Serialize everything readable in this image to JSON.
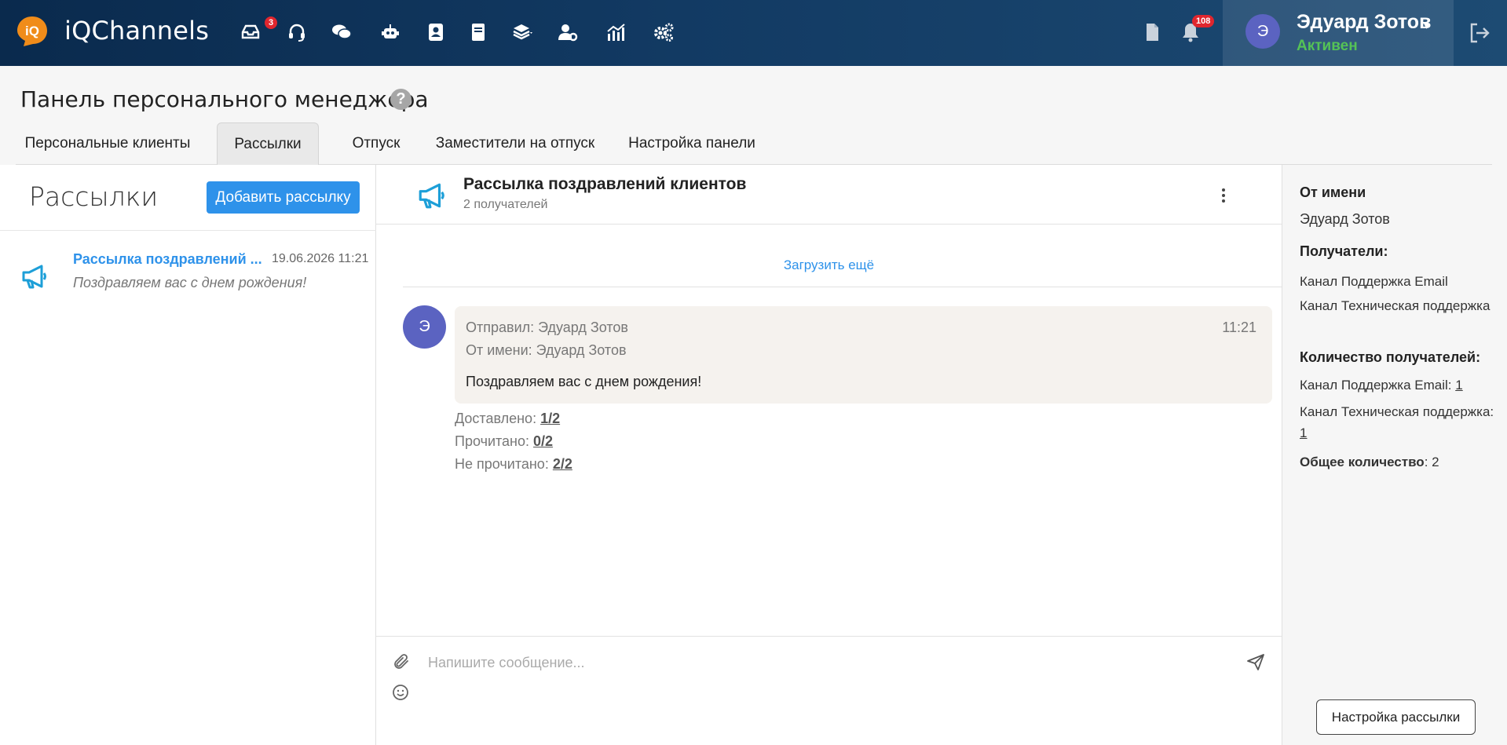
{
  "header": {
    "brand": "iQChannels",
    "nav_icons": [
      "inbox-icon",
      "headset-icon",
      "chat-icon",
      "robot-icon",
      "contacts-icon",
      "book-icon",
      "layers-icon",
      "user-settings-icon",
      "analytics-icon",
      "settings-icon"
    ],
    "inbox_badge": "3",
    "notifications_badge": "108",
    "user": {
      "avatar_letter": "Э",
      "name": "Эдуард Зотов",
      "status": "Активен"
    }
  },
  "page": {
    "title": "Панель персонального менеджера",
    "tabs": [
      {
        "label": "Персональные клиенты"
      },
      {
        "label": "Рассылки"
      },
      {
        "label": "Отпуск"
      },
      {
        "label": "Заместители на отпуск"
      },
      {
        "label": "Настройка панели"
      }
    ],
    "active_tab": "Рассылки"
  },
  "left": {
    "title": "Рассылки",
    "add_button": "Добавить рассылку",
    "items": [
      {
        "title": "Рассылка поздравлений ...",
        "date": "19.06.2026 11:21",
        "preview": "Поздравляем вас с днем рождения!"
      }
    ]
  },
  "center": {
    "title": "Рассылка поздравлений клиентов",
    "subtitle": "2 получателей",
    "load_more": "Загрузить ещё",
    "message": {
      "avatar_letter": "Э",
      "sender": "Отправил: Эдуард Зотов",
      "from": "От имени: Эдуард Зотов",
      "time": "11:21",
      "text": "Поздравляем вас с днем рождения!"
    },
    "stats": {
      "delivered_label": "Доставлено:",
      "delivered_value": "1/2",
      "read_label": "Прочитано:",
      "read_value": "0/2",
      "unread_label": "Не прочитано:",
      "unread_value": "2/2"
    },
    "composer_placeholder": "Напишите сообщение..."
  },
  "right": {
    "from_label": "От имени",
    "from_value": "Эдуард Зотов",
    "recipients_label": "Получатели:",
    "recipients": [
      "Канал Поддержка Email",
      "Канал Техническая поддержка"
    ],
    "count_label": "Количество получателей:",
    "counts": [
      {
        "label": "Канал Поддержка Email:",
        "value": "1"
      },
      {
        "label": "Канал Техническая поддержка:",
        "value": "1"
      }
    ],
    "total_label": "Общее количество",
    "total_value": ": 2",
    "settings_button": "Настройка рассылки"
  },
  "colors": {
    "accent": "#2e92ea",
    "header_dark": "#0a2a4d",
    "status_green": "#55c356",
    "badge_red": "#e0262e",
    "avatar": "#5b63c1"
  }
}
